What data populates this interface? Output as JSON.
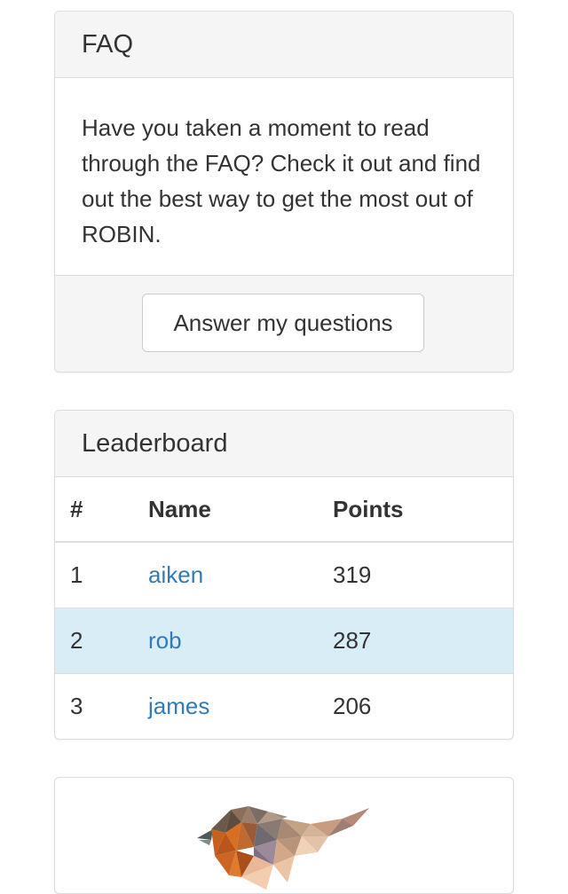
{
  "faq": {
    "title": "FAQ",
    "body": "Have you taken a moment to read through the FAQ? Check it out and find out the best way to get the most out of ROBIN.",
    "button_label": "Answer my questions"
  },
  "leaderboard": {
    "title": "Leaderboard",
    "columns": {
      "rank": "#",
      "name": "Name",
      "points": "Points"
    },
    "rows": [
      {
        "rank": "1",
        "name": "aiken",
        "points": "319"
      },
      {
        "rank": "2",
        "name": "rob",
        "points": "287"
      },
      {
        "rank": "3",
        "name": "james",
        "points": "206"
      }
    ]
  },
  "bird_panel": {
    "logo_icon": "robin-logo-icon"
  }
}
